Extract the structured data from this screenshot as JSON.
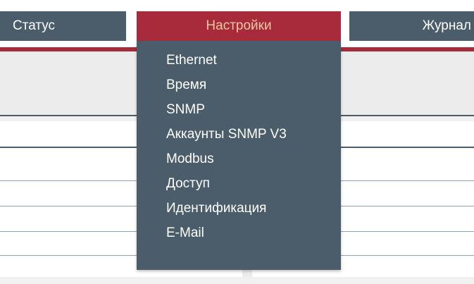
{
  "nav": {
    "tabs": [
      {
        "label": "Статус"
      },
      {
        "label": "Настройки"
      },
      {
        "label": "Журнал"
      }
    ]
  },
  "settings_menu": {
    "items": [
      {
        "label": "Ethernet"
      },
      {
        "label": "Время"
      },
      {
        "label": "SNMP"
      },
      {
        "label": "Аккаунты SNMP V3"
      },
      {
        "label": "Modbus"
      },
      {
        "label": "Доступ"
      },
      {
        "label": "Идентификация"
      },
      {
        "label": "E-Mail"
      }
    ]
  },
  "colors": {
    "nav_bg": "#4b5d6b",
    "active_tab_bg": "#a72b3b",
    "active_tab_text": "#f4c9a2",
    "divider": "#8ea3ba"
  }
}
